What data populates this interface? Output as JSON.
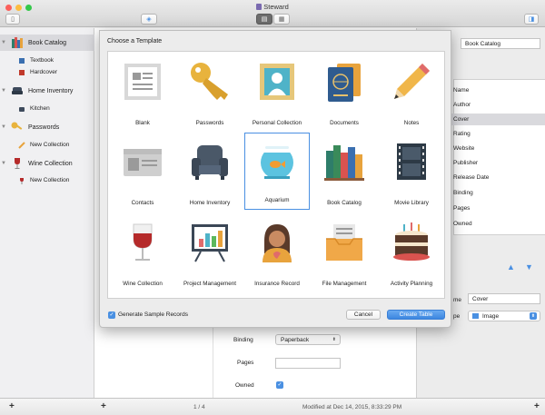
{
  "window": {
    "title": "Steward"
  },
  "sidebar": {
    "groups": [
      {
        "label": "Book Catalog",
        "children": [
          "Textbook",
          "Hardcover"
        ]
      },
      {
        "label": "Home Inventory",
        "children": [
          "Kitchen"
        ]
      },
      {
        "label": "Passwords",
        "children": [
          "New Collection"
        ]
      },
      {
        "label": "Wine Collection",
        "children": [
          "New Collection"
        ]
      }
    ]
  },
  "right_panel": {
    "name_value": "Book Catalog",
    "fields": [
      "Name",
      "Author",
      "Cover",
      "Rating",
      "Website",
      "Publisher",
      "Release Date",
      "Binding",
      "Pages",
      "Owned"
    ],
    "selected_field": "Cover",
    "field_name_label": "me",
    "field_name_value": "Cover",
    "field_type_label": "pe",
    "field_type_value": "Image"
  },
  "detail": {
    "binding_label": "Binding",
    "binding_value": "Paperback",
    "pages_label": "Pages",
    "owned_label": "Owned"
  },
  "statusbar": {
    "page_count": "1 / 4",
    "modified": "Modified at Dec 14, 2015, 8:33:29 PM"
  },
  "modal": {
    "title": "Choose a Template",
    "templates": [
      "Blank",
      "Passwords",
      "Personal Collection",
      "Documents",
      "Notes",
      "Contacts",
      "Home Inventory",
      "Aquarium",
      "Book Catalog",
      "Movie Library",
      "Wine Collection",
      "Project Management",
      "Insurance Record",
      "File Management",
      "Activity Planning"
    ],
    "selected_template": "Aquarium",
    "checkbox_label": "Generate Sample Records",
    "cancel_label": "Cancel",
    "create_label": "Create Table"
  },
  "colors": {
    "accent": "#4a90e2",
    "selection": "#d9d9dd"
  }
}
